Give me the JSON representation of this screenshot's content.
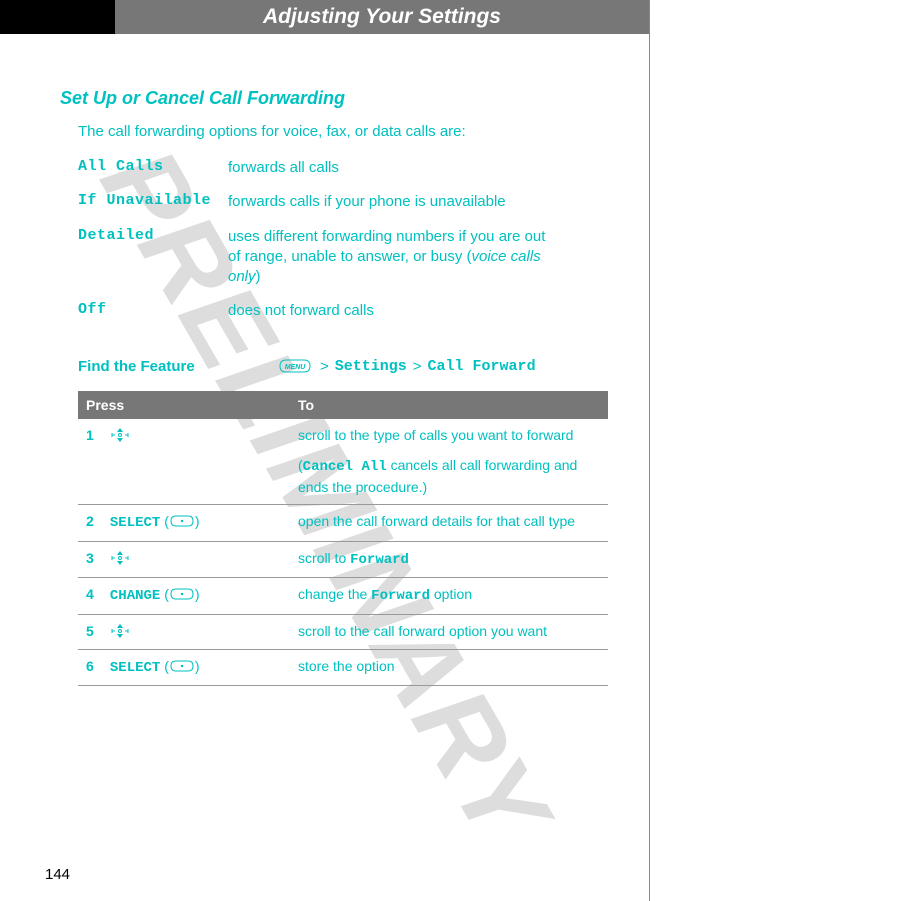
{
  "watermark": "PRELIMINARY",
  "header_title": "Adjusting Your Settings",
  "section_title": "Set Up or Cancel Call Forwarding",
  "intro": "The call forwarding options for voice, fax, or data calls are:",
  "options": [
    {
      "term": "All Calls",
      "desc": "forwards all calls"
    },
    {
      "term": "If Unavailable",
      "desc": "forwards calls if your phone is unavailable"
    },
    {
      "term": "Detailed",
      "desc": "uses different forwarding numbers if you are out of range, unable to answer, or busy (",
      "desc_em": "voice calls only",
      "desc_after": ")"
    },
    {
      "term": "Off",
      "desc": "does not forward calls"
    }
  ],
  "find_label": "Find the Feature",
  "find_path": {
    "p1": "Settings",
    "p2": "Call Forward"
  },
  "table_headers": {
    "press": "Press",
    "to": "To"
  },
  "steps": [
    {
      "num": "1",
      "press_kind": "nav",
      "to_a": "scroll to the type of calls you want to forward",
      "to_b_pre": "(",
      "to_b_mono": "Cancel All",
      "to_b_post": " cancels all call forwarding and ends the procedure.)"
    },
    {
      "num": "2",
      "press_kind": "soft",
      "press_label": "SELECT",
      "to_a": "open the call forward details for that call type"
    },
    {
      "num": "3",
      "press_kind": "nav",
      "to_a_pre": "scroll to ",
      "to_a_mono": "Forward"
    },
    {
      "num": "4",
      "press_kind": "soft",
      "press_label": "CHANGE",
      "to_a_pre": "change the ",
      "to_a_mono": "Forward",
      "to_a_post": " option"
    },
    {
      "num": "5",
      "press_kind": "nav",
      "to_a": "scroll to the call forward option you want"
    },
    {
      "num": "6",
      "press_kind": "soft",
      "press_label": "SELECT",
      "to_a": "store the option"
    }
  ],
  "page_number": "144"
}
